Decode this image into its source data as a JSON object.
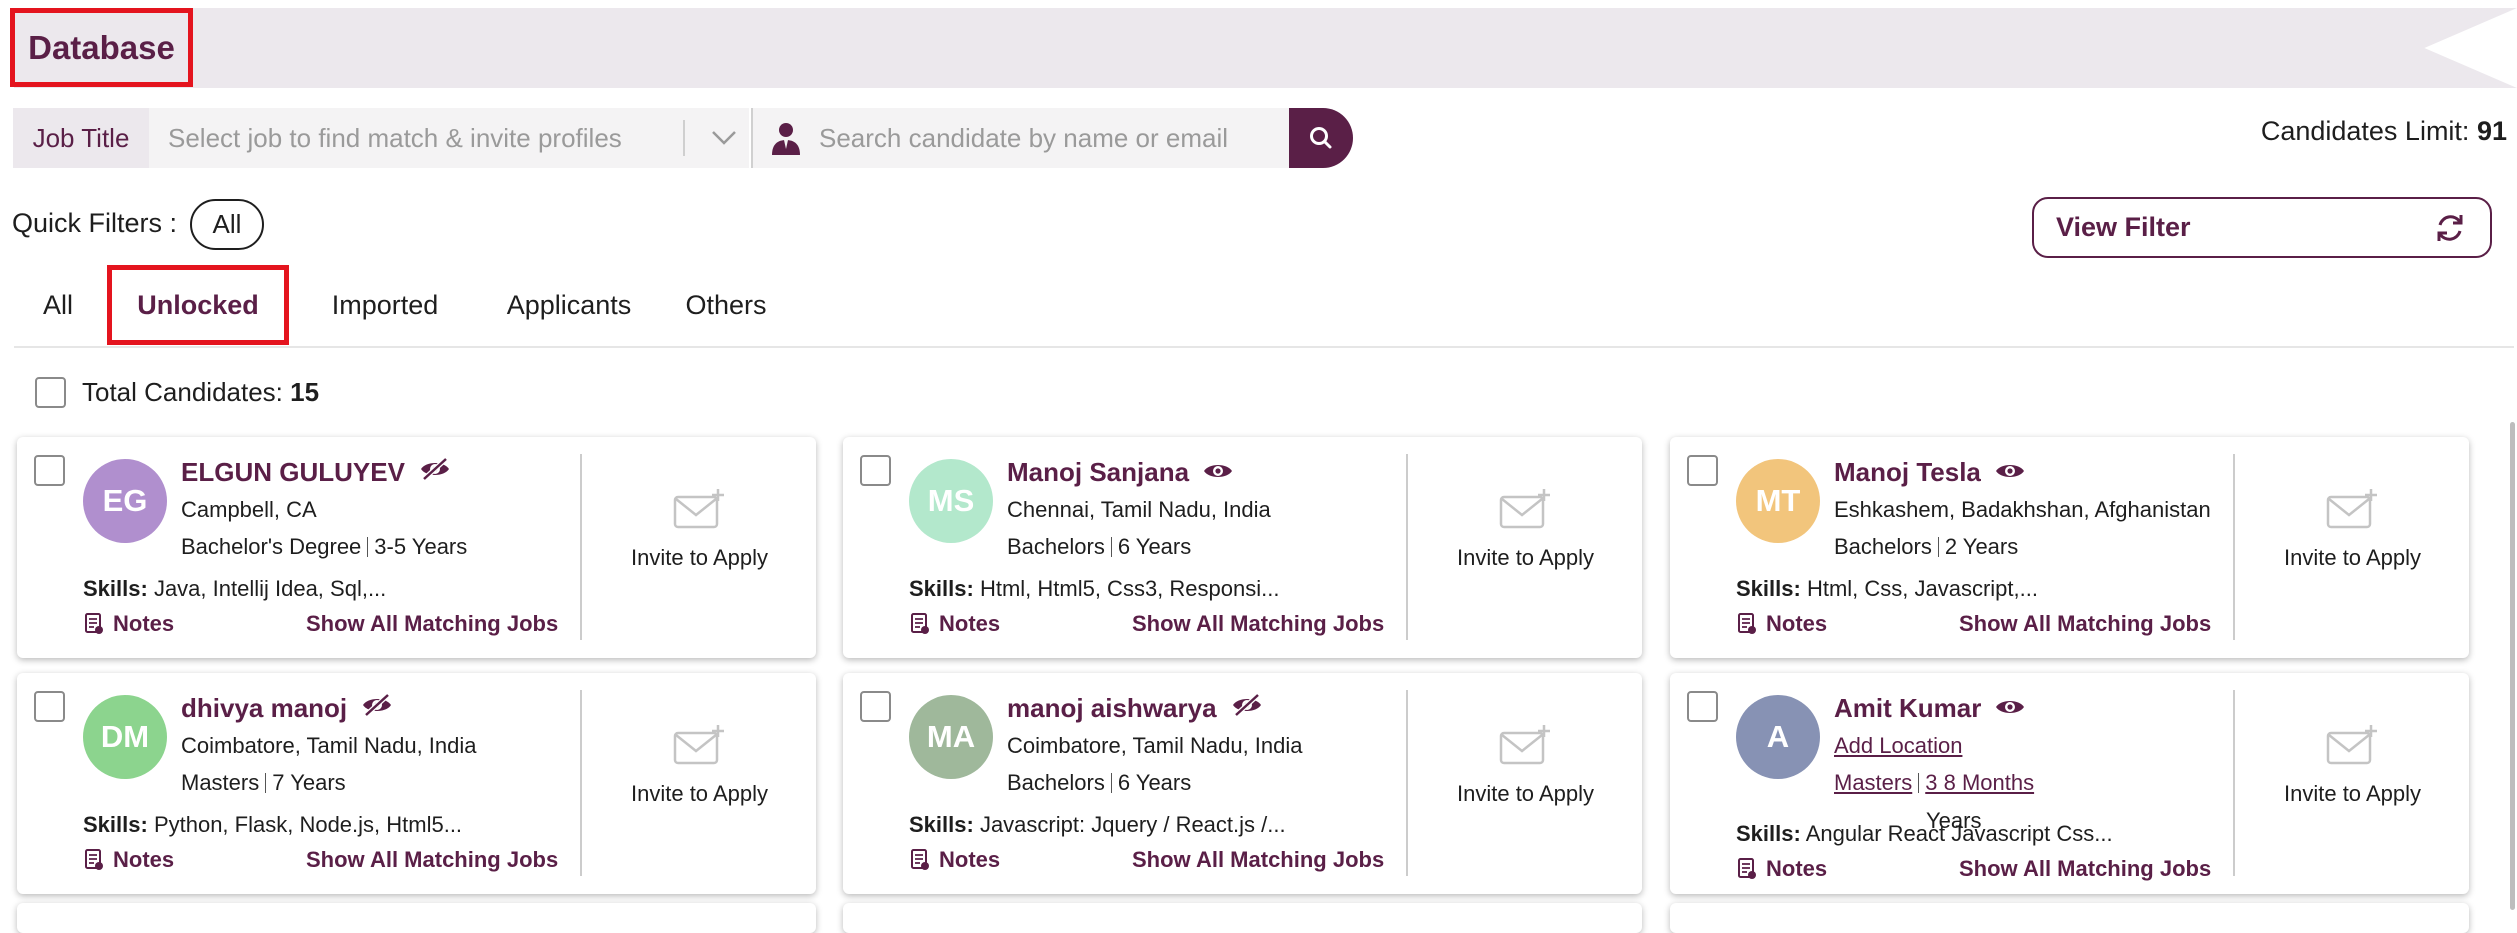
{
  "header": {
    "title": "Database"
  },
  "search": {
    "job_label": "Job Title",
    "job_placeholder": "Select job to find match & invite profiles",
    "candidate_placeholder": "Search candidate by name or email",
    "limit_label": "Candidates Limit:",
    "limit_value": "91"
  },
  "quick_filters": {
    "label": "Quick Filters :",
    "chip": "All"
  },
  "view_filter": {
    "label": "View Filter"
  },
  "tabs": [
    {
      "label": "All"
    },
    {
      "label": "Unlocked"
    },
    {
      "label": "Imported"
    },
    {
      "label": "Applicants"
    },
    {
      "label": "Others"
    }
  ],
  "active_tab": "Unlocked",
  "total": {
    "label": "Total Candidates:",
    "value": "15"
  },
  "colors": {
    "brand": "#5a1f47",
    "highlight": "#e4141e",
    "banner": "#ece8ed"
  },
  "common": {
    "invite_label": "Invite to Apply",
    "notes_label": "Notes",
    "matching_label": "Show All Matching Jobs",
    "skills_label": "Skills:"
  },
  "candidates": [
    {
      "initials": "EG",
      "name": "ELGUN GULUYEV",
      "visibility_icon": "eye-slash-icon",
      "avatar_color": "#b08fce",
      "location": "Campbell, CA",
      "degree": "Bachelor's Degree",
      "experience": "3-5 Years",
      "skills": "Java, Intellij Idea, Sql,..."
    },
    {
      "initials": "MS",
      "name": "Manoj Sanjana",
      "visibility_icon": "eye-icon",
      "avatar_color": "#b3e8cc",
      "location": "Chennai, Tamil Nadu, India",
      "degree": "Bachelors",
      "experience": "6 Years",
      "skills": "Html, Html5, Css3, Responsi..."
    },
    {
      "initials": "MT",
      "name": "Manoj Tesla",
      "visibility_icon": "eye-icon",
      "avatar_color": "#f2c57c",
      "location": "Eshkashem, Badakhshan, Afghanistan",
      "degree": "Bachelors",
      "experience": "2 Years",
      "skills": "Html, Css, Javascript,..."
    },
    {
      "initials": "DM",
      "name": "dhivya manoj",
      "visibility_icon": "eye-slash-icon",
      "avatar_color": "#8cd48e",
      "location": "Coimbatore, Tamil Nadu, India",
      "degree": "Masters",
      "experience": "7 Years",
      "skills": "Python, Flask, Node.js, Html5..."
    },
    {
      "initials": "MA",
      "name": "manoj aishwarya",
      "visibility_icon": "eye-slash-icon",
      "avatar_color": "#9fb89b",
      "location": "Coimbatore, Tamil Nadu, India",
      "degree": "Bachelors",
      "experience": "6 Years",
      "skills": "Javascript: Jquery / React.js /..."
    },
    {
      "initials": "A",
      "name": "Amit Kumar",
      "visibility_icon": "eye-icon",
      "avatar_color": "#8792b4",
      "location": "Add Location",
      "degree": "Masters",
      "experience": "3 8 Months",
      "experience_overflow": "Years",
      "skills": "Angular React Javascript Css..."
    }
  ]
}
